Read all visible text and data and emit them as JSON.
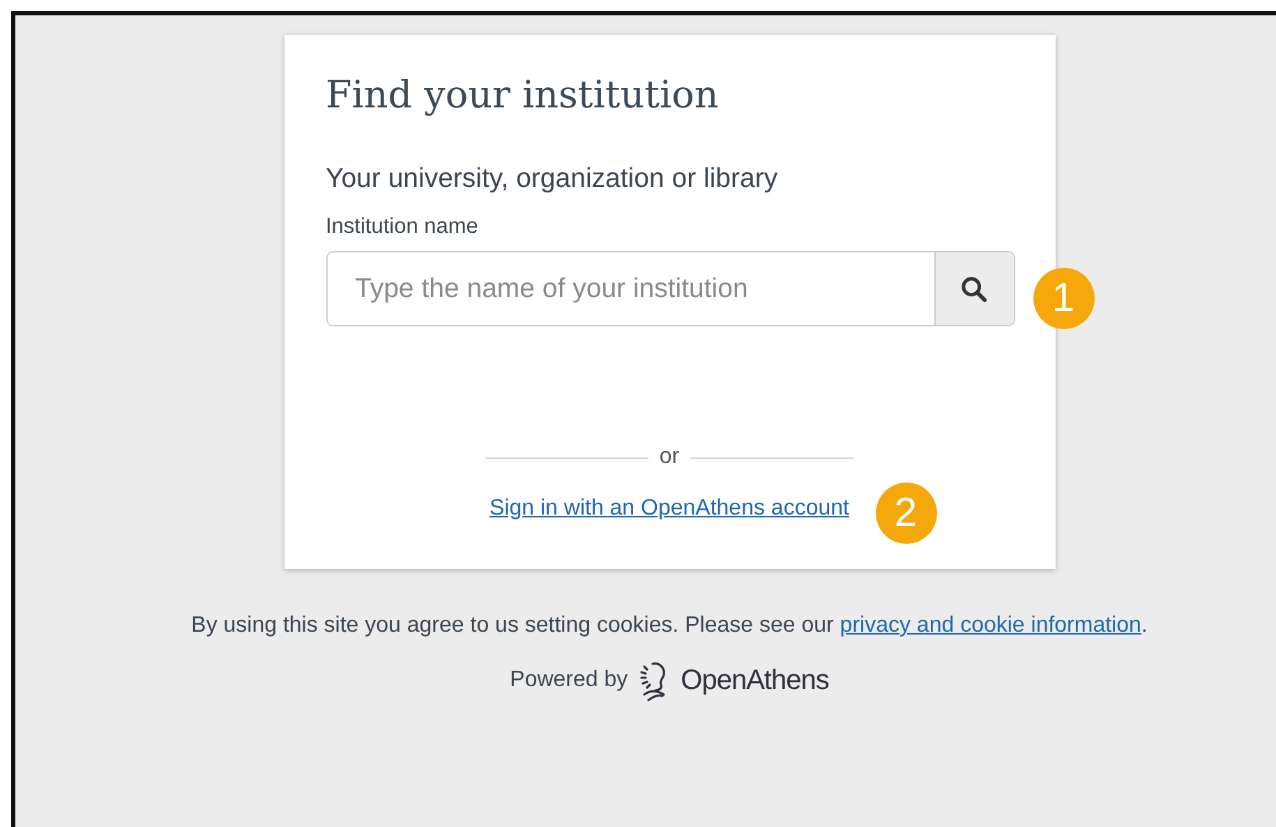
{
  "card": {
    "title": "Find your institution",
    "subtitle": "Your university, organization or library",
    "field_label": "Institution name",
    "search": {
      "placeholder": "Type the name of your institution"
    },
    "divider": "or",
    "signin_link": "Sign in with an OpenAthens account"
  },
  "callouts": [
    "1",
    "2"
  ],
  "footer": {
    "notice": "By using this site you agree to us setting cookies. Please see our ",
    "notice_link": "privacy and cookie information",
    "notice_end": ".",
    "powered_by": "Powered by",
    "brand": "OpenAthens"
  }
}
